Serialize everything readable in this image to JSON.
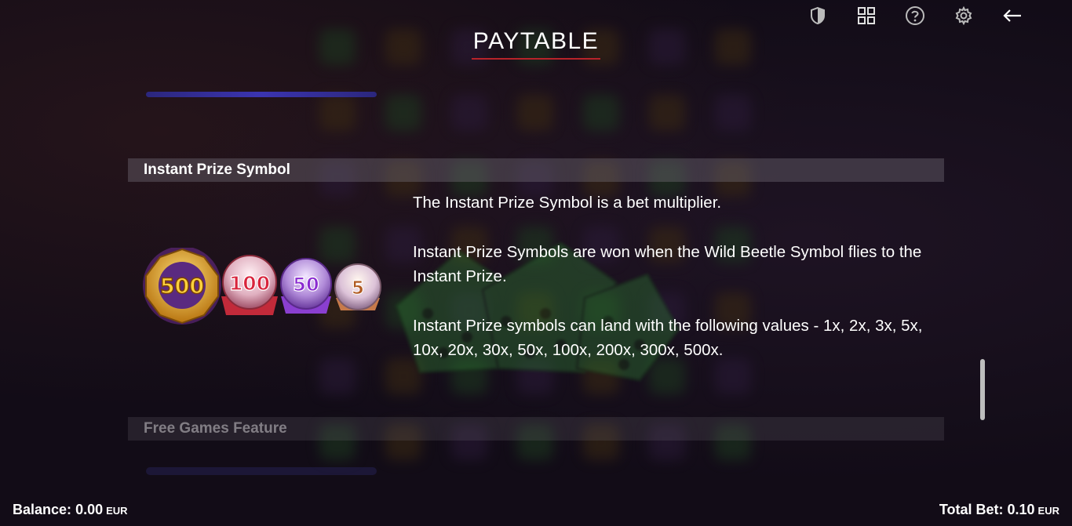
{
  "header": {
    "title": "PAYTABLE",
    "icons": [
      "shield-icon",
      "grid-icon",
      "help-icon",
      "settings-icon",
      "back-arrow-icon"
    ]
  },
  "sections": [
    {
      "heading": "Instant Prize Symbol",
      "symbols": [
        "500",
        "100",
        "50",
        "5"
      ],
      "paragraphs": [
        "The Instant Prize Symbol is a bet multiplier.",
        "Instant Prize Symbols are won when the Wild Beetle Symbol flies to the Instant Prize.",
        "Instant Prize symbols can land with the following values - 1x, 2x, 3x, 5x, 10x, 20x, 30x, 50x, 100x, 200x, 300x, 500x."
      ]
    },
    {
      "heading": "Free Games Feature"
    }
  ],
  "footer": {
    "balance_label": "Balance:",
    "balance_value": "0.00",
    "balance_currency": "EUR",
    "bet_label": "Total Bet:",
    "bet_value": "0.10",
    "bet_currency": "EUR"
  },
  "colors": {
    "title_underline": "#b8232a",
    "gold": "#e0a020",
    "red_orb": "#d8324a",
    "purple_orb": "#8a3fd0",
    "bronze_orb": "#c77a4a"
  }
}
